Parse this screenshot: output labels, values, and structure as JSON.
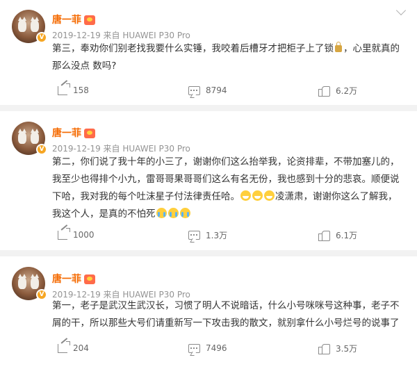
{
  "posts": [
    {
      "author": "唐一菲",
      "meta": "2019-12-19  来自 HUAWEI P30 Pro",
      "text_a": "第三，奉劝你们别老找我要什么实锤，我咬着后槽牙才把柜子上了锁",
      "text_b": "，心里就真的那么没点   数吗?",
      "shares": "158",
      "comments": "8794",
      "likes": "6.2万"
    },
    {
      "author": "唐一菲",
      "meta": "2019-12-19  来自 HUAWEI P30 Pro",
      "text_a": "第二，你们说了我十年的小三了，谢谢你们这么抬举我，论资排辈，不带加塞儿的，我至少也得排个小九，雷哥哥果哥哥们这么有名无份，我也感到十分的悲哀。顺便说下哈，我对我的每个吐沫星子付法律责任哈。",
      "text_b": "凌潇肃，谢谢你这么了解我，我这个人，是真的不怕死",
      "shares": "1000",
      "comments": "1.3万",
      "likes": "6.1万"
    },
    {
      "author": "唐一菲",
      "meta": "2019-12-19  来自 HUAWEI P30 Pro",
      "text_a": "第一，老子是武汉生武汉长，习惯了明人不说暗话，什么小号咪咪号这种事，老子不屑的干，所以那些大号们请重新写一下攻击我的散文，就别拿什么小号烂号的说事了",
      "text_b": "",
      "shares": "204",
      "comments": "7496",
      "likes": "3.5万"
    }
  ],
  "icons": {
    "share": "share-icon",
    "comment": "comment-icon",
    "like": "thumbs-up-icon",
    "more": "chevron-down-icon",
    "verified": "verified-v-icon",
    "member": "vip-member-icon"
  },
  "colors": {
    "author_name": "#f56a00",
    "meta": "#939393",
    "background": "#f2f2f2",
    "verified_badge": "#f6a623"
  }
}
